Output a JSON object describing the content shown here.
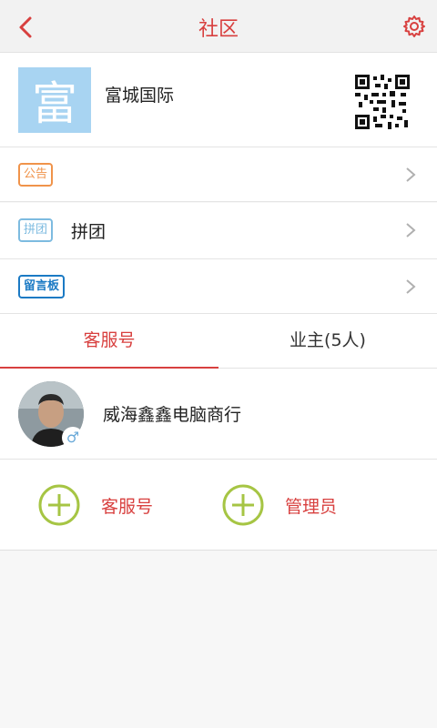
{
  "header": {
    "title": "社区",
    "back_icon": "chevron-left-icon",
    "settings_icon": "gear-icon"
  },
  "community": {
    "logo_text": "富",
    "name": "富城国际",
    "qr_icon": "qr-code-icon"
  },
  "rows": [
    {
      "tag": "公告",
      "label": ""
    },
    {
      "tag": "拼团",
      "label": "拼团"
    },
    {
      "tag": "留言板",
      "label": ""
    }
  ],
  "tabs": [
    {
      "label": "客服号",
      "active": true
    },
    {
      "label": "业主(5人)",
      "active": false
    }
  ],
  "member": {
    "name": "威海鑫鑫电脑商行",
    "gender_symbol": "♂"
  },
  "actions": [
    {
      "label": "客服号",
      "icon": "plus-circle-icon"
    },
    {
      "label": "管理员",
      "icon": "plus-circle-icon"
    }
  ],
  "colors": {
    "accent": "#d8403f",
    "plus_green": "#a6c544",
    "logo_bg": "#a8d4f2"
  }
}
